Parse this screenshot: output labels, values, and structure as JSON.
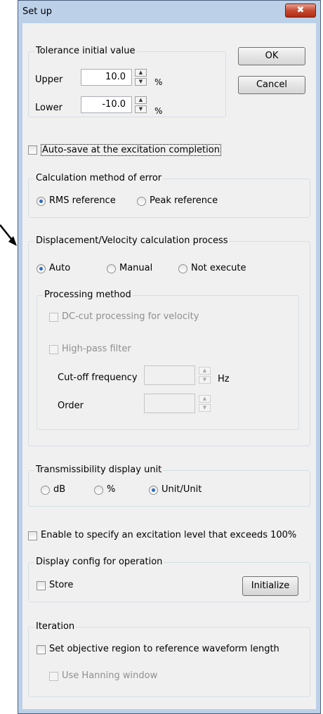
{
  "window": {
    "title": "Set up",
    "close_glyph": "✖"
  },
  "tolerance": {
    "group_label": "Tolerance initial value",
    "upper_label": "Upper",
    "upper_value": "10.0",
    "upper_unit": "%",
    "lower_label": "Lower",
    "lower_value": "-10.0",
    "lower_unit": "%"
  },
  "buttons": {
    "ok": "OK",
    "cancel": "Cancel",
    "initialize": "Initialize"
  },
  "autosave": {
    "label": "Auto-save at the excitation completion",
    "checked": false
  },
  "calc_error": {
    "group_label": "Calculation method of error",
    "options": [
      "RMS reference",
      "Peak reference"
    ],
    "selected": "RMS reference"
  },
  "displacement": {
    "group_label": "Displacement/Velocity calculation process",
    "options": [
      "Auto",
      "Manual",
      "Not execute"
    ],
    "selected": "Auto",
    "processing": {
      "group_label": "Processing method",
      "dc_cut_label": "DC-cut processing for velocity",
      "highpass_label": "High-pass filter",
      "cutoff_label": "Cut-off frequency",
      "cutoff_unit": "Hz",
      "order_label": "Order"
    }
  },
  "transmissibility": {
    "group_label": "Transmissibility display unit",
    "options": [
      "dB",
      "%",
      "Unit/Unit"
    ],
    "selected": "Unit/Unit"
  },
  "exceed": {
    "label": "Enable to specify an excitation level that exceeds 100%",
    "checked": false
  },
  "display_config": {
    "group_label": "Display config for operation",
    "store_label": "Store"
  },
  "iteration": {
    "group_label": "Iteration",
    "objective_label": "Set objective region to reference waveform length",
    "hanning_label": "Use Hanning window"
  },
  "icons": {
    "spin_up": "▲",
    "spin_down": "▼"
  }
}
